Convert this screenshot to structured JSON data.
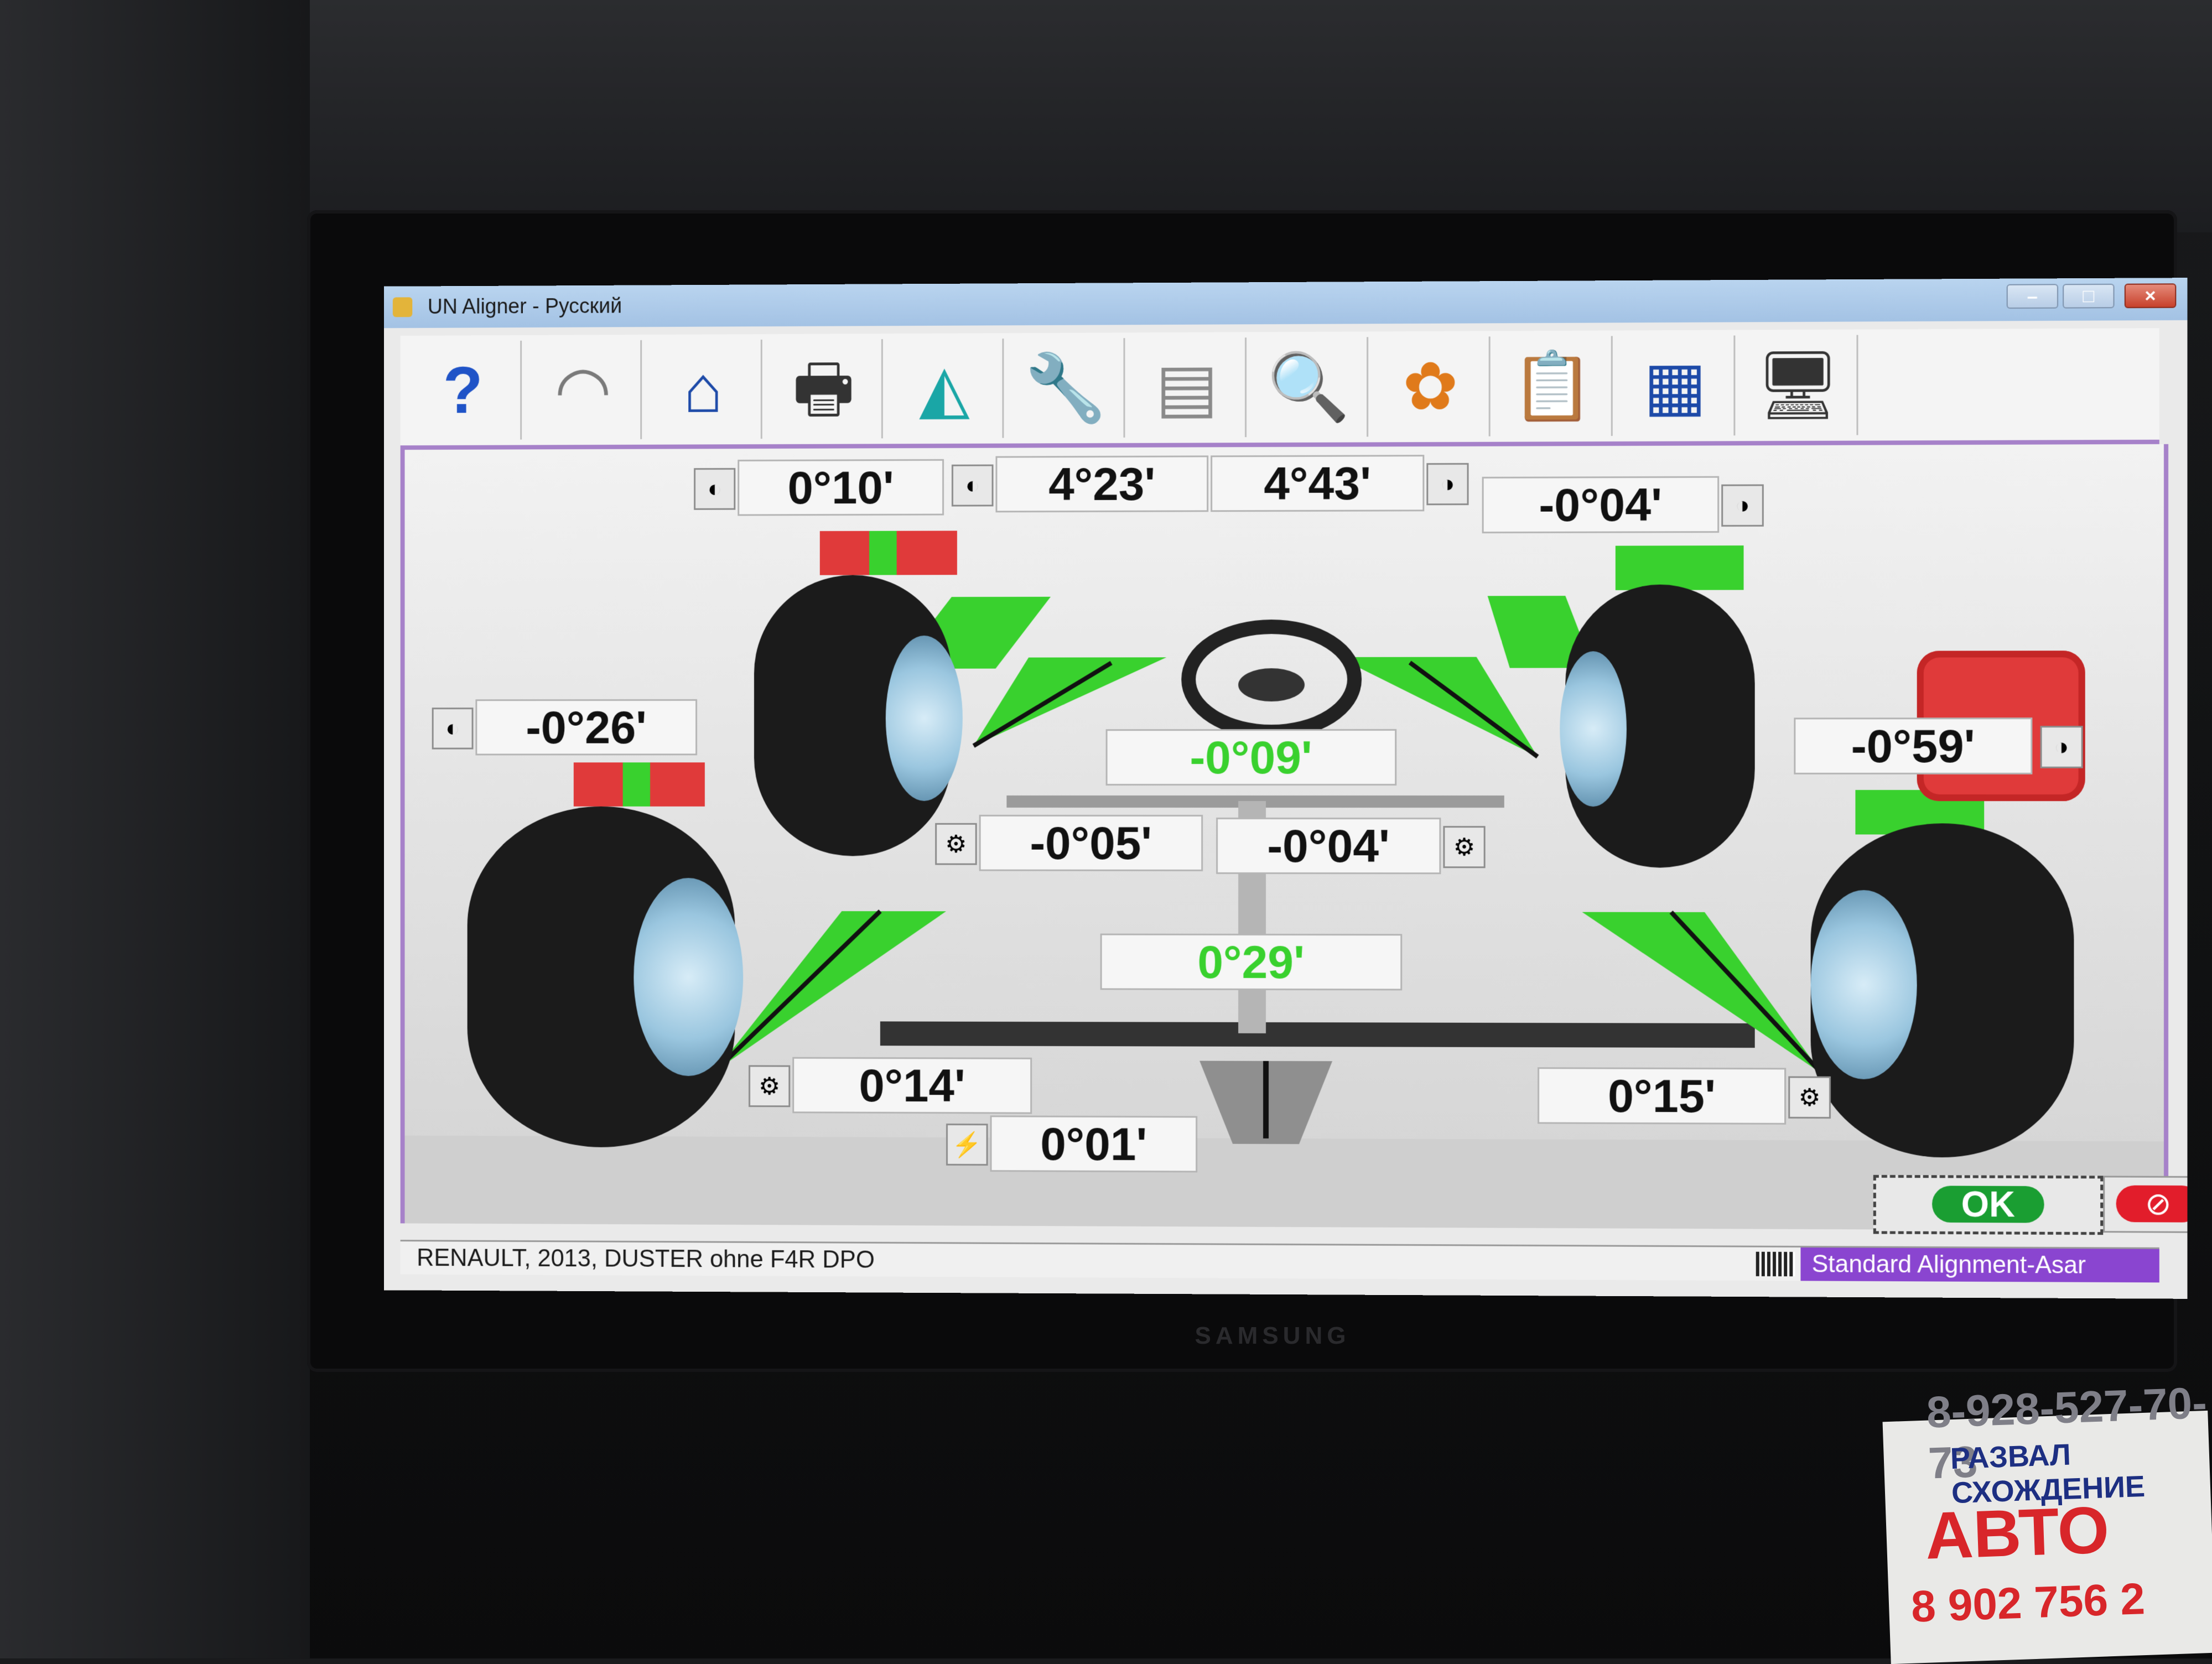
{
  "window": {
    "title": "UN Aligner - Русский",
    "minimize": "–",
    "maximize": "□",
    "close": "×"
  },
  "toolbar": {
    "items": [
      {
        "name": "help-icon",
        "glyph": "?",
        "color": "#1f53c7"
      },
      {
        "name": "gauge-icon",
        "glyph": "◠",
        "color": "#7a7a7a"
      },
      {
        "name": "home-icon",
        "glyph": "⌂",
        "color": "#1d4aa8"
      },
      {
        "name": "printer-icon",
        "glyph": "🖶",
        "color": "#333333"
      },
      {
        "name": "protractor-icon",
        "glyph": "◭",
        "color": "#1aa6a6"
      },
      {
        "name": "wrench-icon",
        "glyph": "🔧",
        "color": "#1d4aa8"
      },
      {
        "name": "film-icon",
        "glyph": "▤",
        "color": "#8a8a8a"
      },
      {
        "name": "zoom-icon",
        "glyph": "🔍",
        "color": "#1d4aa8"
      },
      {
        "name": "settings-flower-icon",
        "glyph": "✿",
        "color": "#e07a1a"
      },
      {
        "name": "clipboard-icon",
        "glyph": "📋",
        "color": "#333333"
      },
      {
        "name": "table-icon",
        "glyph": "▦",
        "color": "#1d4aa8"
      },
      {
        "name": "monitor-tools-icon",
        "glyph": "🖥",
        "color": "#333333"
      }
    ]
  },
  "readings": {
    "front_left_camber": "0°10'",
    "front_left_caster": "4°23'",
    "front_right_caster": "4°43'",
    "front_right_camber": "-0°04'",
    "rear_left_camber": "-0°26'",
    "rear_right_camber": "-0°59'",
    "steering_angle": "-0°09'",
    "front_left_toe": "-0°05'",
    "front_right_toe": "-0°04'",
    "total_toe_rear": "0°29'",
    "rear_left_toe": "0°14'",
    "rear_right_toe": "0°15'",
    "thrust_angle": "0°01'"
  },
  "buttons": {
    "ok": "OK",
    "cancel": "⊘"
  },
  "status": {
    "vehicle": "RENAULT, 2013, DUSTER ohne F4R DPO",
    "program": "Standard Alignment-Asar"
  },
  "background": {
    "brand": "SAMSUNG",
    "sticker_phone": "8-928-527-70-73",
    "sticker_line1": "РАЗВАЛ СХОЖДЕНИЕ",
    "sticker_line2": "АВТО",
    "sticker_line3": "8 902 756 2"
  },
  "colors": {
    "accent_purple": "#a681c9",
    "status_purple": "#8a45d0",
    "ok_green": "#1a9e32",
    "cancel_red": "#e21d2b",
    "indicator_green": "#39d12e"
  }
}
